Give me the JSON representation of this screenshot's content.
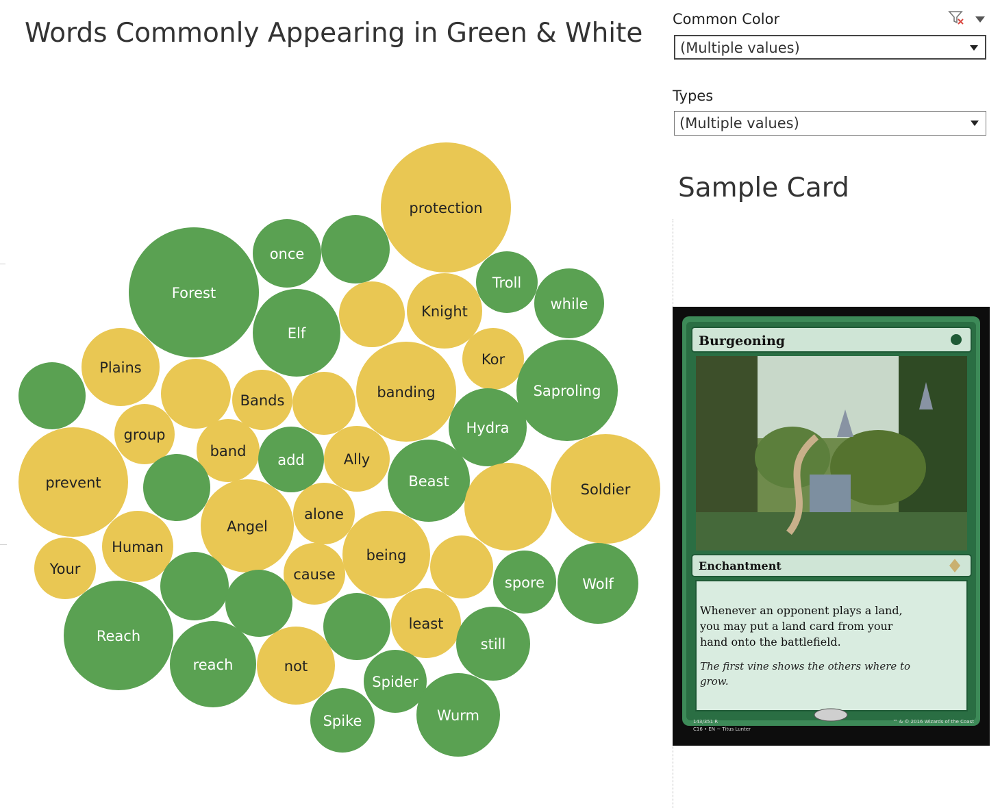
{
  "title": "Words Commonly Appearing in Green & White",
  "filters": {
    "common_color": {
      "label": "Common Color",
      "value": "(Multiple values)"
    },
    "types": {
      "label": "Types",
      "value": "(Multiple values)"
    }
  },
  "sample_card": {
    "heading": "Sample Card",
    "name": "Burgeoning",
    "type_line": "Enchantment",
    "rules_text": [
      "Whenever an opponent plays a land,",
      "you may put a land card from your",
      "hand onto the battlefield."
    ],
    "flavor_text": [
      "The first vine shows the others where to",
      "grow."
    ],
    "collector": [
      "143/351 R",
      "C16 • EN ~ Titus Lunter"
    ],
    "legal": "™ & © 2016 Wizards of the Coast"
  },
  "colors": {
    "green": "#5aa152",
    "gold": "#e9c753"
  },
  "chart_data": {
    "type": "bubble",
    "title": "Words Commonly Appearing in Green & White",
    "legend": "none",
    "bubbles": [
      {
        "label": "protection",
        "color": "gold",
        "size": 9025
      },
      {
        "label": "once",
        "color": "green",
        "size": 2500
      },
      {
        "label": "",
        "color": "green",
        "size": 2500
      },
      {
        "label": "Forest",
        "color": "green",
        "size": 9025
      },
      {
        "label": "Troll",
        "color": "green",
        "size": 2025
      },
      {
        "label": "while",
        "color": "green",
        "size": 2601
      },
      {
        "label": "Elf",
        "color": "green",
        "size": 4096
      },
      {
        "label": "",
        "color": "gold",
        "size": 2304
      },
      {
        "label": "Knight",
        "color": "gold",
        "size": 3025
      },
      {
        "label": "Kor",
        "color": "gold",
        "size": 2025
      },
      {
        "label": "Plains",
        "color": "gold",
        "size": 3249
      },
      {
        "label": "",
        "color": "green",
        "size": 2401
      },
      {
        "label": "",
        "color": "gold",
        "size": 2601
      },
      {
        "label": "Bands",
        "color": "gold",
        "size": 1936
      },
      {
        "label": "",
        "color": "gold",
        "size": 2116
      },
      {
        "label": "banding",
        "color": "gold",
        "size": 5329
      },
      {
        "label": "Saproling",
        "color": "green",
        "size": 5476
      },
      {
        "label": "group",
        "color": "gold",
        "size": 1936
      },
      {
        "label": "Hydra",
        "color": "green",
        "size": 3249
      },
      {
        "label": "band",
        "color": "gold",
        "size": 2116
      },
      {
        "label": "add",
        "color": "green",
        "size": 2304
      },
      {
        "label": "Ally",
        "color": "gold",
        "size": 2304
      },
      {
        "label": "prevent",
        "color": "gold",
        "size": 6400
      },
      {
        "label": "",
        "color": "green",
        "size": 2401
      },
      {
        "label": "Beast",
        "color": "green",
        "size": 3600
      },
      {
        "label": "",
        "color": "gold",
        "size": 4096
      },
      {
        "label": "Soldier",
        "color": "gold",
        "size": 6400
      },
      {
        "label": "Angel",
        "color": "gold",
        "size": 4624
      },
      {
        "label": "alone",
        "color": "gold",
        "size": 2025
      },
      {
        "label": "Human",
        "color": "gold",
        "size": 2704
      },
      {
        "label": "being",
        "color": "gold",
        "size": 4096
      },
      {
        "label": "Your",
        "color": "gold",
        "size": 2025
      },
      {
        "label": "",
        "color": "green",
        "size": 2500
      },
      {
        "label": "cause",
        "color": "gold",
        "size": 2025
      },
      {
        "label": "",
        "color": "gold",
        "size": 2116
      },
      {
        "label": "spore",
        "color": "green",
        "size": 2116
      },
      {
        "label": "Wolf",
        "color": "green",
        "size": 3481
      },
      {
        "label": "",
        "color": "green",
        "size": 2401
      },
      {
        "label": "Reach",
        "color": "green",
        "size": 6400
      },
      {
        "label": "",
        "color": "green",
        "size": 2401
      },
      {
        "label": "least",
        "color": "gold",
        "size": 2601
      },
      {
        "label": "still",
        "color": "green",
        "size": 2916
      },
      {
        "label": "reach",
        "color": "green",
        "size": 3969
      },
      {
        "label": "not",
        "color": "gold",
        "size": 3249
      },
      {
        "label": "Spider",
        "color": "green",
        "size": 2116
      },
      {
        "label": "Wurm",
        "color": "green",
        "size": 3721
      },
      {
        "label": "Spike",
        "color": "green",
        "size": 2209
      }
    ]
  }
}
